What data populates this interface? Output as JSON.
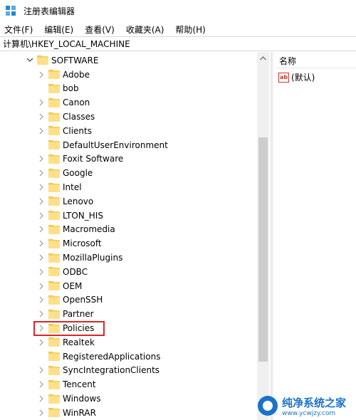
{
  "window": {
    "title": "注册表编辑器"
  },
  "menu": [
    "文件(F)",
    "编辑(E)",
    "查看(V)",
    "收藏夹(A)",
    "帮助(H)"
  ],
  "address": "计算机\\HKEY_LOCAL_MACHINE",
  "tree": {
    "parent": "SOFTWARE",
    "items": [
      {
        "label": "Adobe",
        "has_children": true
      },
      {
        "label": "bob",
        "has_children": false
      },
      {
        "label": "Canon",
        "has_children": true
      },
      {
        "label": "Classes",
        "has_children": true
      },
      {
        "label": "Clients",
        "has_children": true
      },
      {
        "label": "DefaultUserEnvironment",
        "has_children": false
      },
      {
        "label": "Foxit Software",
        "has_children": true
      },
      {
        "label": "Google",
        "has_children": true
      },
      {
        "label": "Intel",
        "has_children": true
      },
      {
        "label": "Lenovo",
        "has_children": true
      },
      {
        "label": "LTON_HIS",
        "has_children": true
      },
      {
        "label": "Macromedia",
        "has_children": true
      },
      {
        "label": "Microsoft",
        "has_children": true
      },
      {
        "label": "MozillaPlugins",
        "has_children": true
      },
      {
        "label": "ODBC",
        "has_children": true
      },
      {
        "label": "OEM",
        "has_children": true
      },
      {
        "label": "OpenSSH",
        "has_children": true
      },
      {
        "label": "Partner",
        "has_children": true
      },
      {
        "label": "Policies",
        "has_children": true,
        "highlighted": true
      },
      {
        "label": "Realtek",
        "has_children": true
      },
      {
        "label": "RegisteredApplications",
        "has_children": false
      },
      {
        "label": "SyncIntegrationClients",
        "has_children": true
      },
      {
        "label": "Tencent",
        "has_children": true
      },
      {
        "label": "Windows",
        "has_children": true
      },
      {
        "label": "WinRAR",
        "has_children": true
      }
    ]
  },
  "values_pane": {
    "column_name": "名称",
    "rows": [
      {
        "icon": "string-value-icon",
        "badge": "ab",
        "name": "(默认)"
      }
    ]
  },
  "watermark": {
    "main": "纯净系统之家",
    "sub": "www.ycwjzy.com"
  },
  "colors": {
    "highlight": "#d9262a",
    "folder": "#f6d25f",
    "accent": "#1b73c7"
  }
}
